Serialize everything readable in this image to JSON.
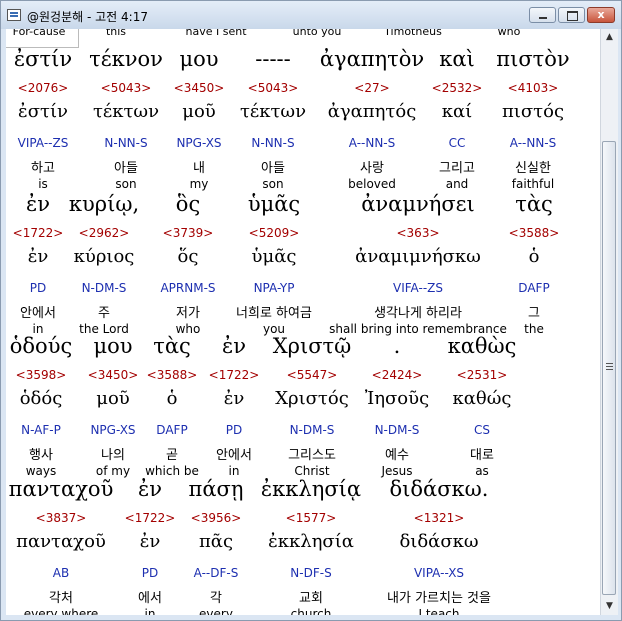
{
  "window": {
    "title": "@원겅분해 - 고전 4:17"
  },
  "window_buttons": {
    "close": "x"
  },
  "header_row": [
    "For-cause",
    "this",
    "have I sent",
    "unto you",
    "Timotheus",
    "who"
  ],
  "blocks": [
    {
      "words": [
        {
          "greek": "ἐστίν",
          "strong": "<2076>",
          "lemma": "ἐστίν",
          "morph": "VIPA--ZS",
          "korean": "하고",
          "english": "is"
        },
        {
          "greek": "τέκνον",
          "strong": "<5043>",
          "lemma": "τέκτων",
          "morph": "N-NN-S",
          "korean": "아들",
          "english": "son"
        },
        {
          "greek": "μου",
          "strong": "<3450>",
          "lemma": "μοῦ",
          "morph": "NPG-XS",
          "korean": "내",
          "english": "my"
        },
        {
          "greek": "-----",
          "strong": "<5043>",
          "lemma": "τέκτων",
          "morph": "N-NN-S",
          "korean": "아들",
          "english": "son"
        },
        {
          "greek": "ἀγαπητὸν",
          "strong": "<27>",
          "lemma": "ἀγαπητός",
          "morph": "A--NN-S",
          "korean": "사랑",
          "english": "beloved"
        },
        {
          "greek": "καὶ",
          "strong": "<2532>",
          "lemma": "καί",
          "morph": "CC",
          "korean": "그리고",
          "english": "and"
        },
        {
          "greek": "πιστὸν",
          "strong": "<4103>",
          "lemma": "πιστός",
          "morph": "A--NN-S",
          "korean": "신실한",
          "english": "faithful"
        }
      ]
    },
    {
      "words": [
        {
          "greek": "ἐν",
          "strong": "<1722>",
          "lemma": "ἐν",
          "morph": "PD",
          "korean": "안에서",
          "english": "in"
        },
        {
          "greek": "κυρίῳ,",
          "strong": "<2962>",
          "lemma": "κύριος",
          "morph": "N-DM-S",
          "korean": "주",
          "english": "the Lord"
        },
        {
          "greek": "ὃς",
          "strong": "<3739>",
          "lemma": "ὅς",
          "morph": "APRNM-S",
          "korean": "저가",
          "english": "who"
        },
        {
          "greek": "ὑμᾶς",
          "strong": "<5209>",
          "lemma": "ὑμᾶς",
          "morph": "NPA-YP",
          "korean": "너희로 하여금",
          "english": "you"
        },
        {
          "greek": "ἀναμνήσει",
          "strong": "<363>",
          "lemma": "ἀναμιμνήσκω",
          "morph": "VIFA--ZS",
          "korean": "생각나게 하리라",
          "english": "shall bring into remembrance"
        },
        {
          "greek": "τὰς",
          "strong": "<3588>",
          "lemma": "ὁ",
          "morph": "DAFP",
          "korean": "그",
          "english": "the"
        }
      ]
    },
    {
      "words": [
        {
          "greek": "ὁδούς",
          "strong": "<3598>",
          "lemma": "ὁδός",
          "morph": "N-AF-P",
          "korean": "행사",
          "english": "ways"
        },
        {
          "greek": "μου",
          "strong": "<3450>",
          "lemma": "μοῦ",
          "morph": "NPG-XS",
          "korean": "나의",
          "english": "of my"
        },
        {
          "greek": "τὰς",
          "strong": "<3588>",
          "lemma": "ὁ",
          "morph": "DAFP",
          "korean": "곧",
          "english": "which be"
        },
        {
          "greek": "ἐν",
          "strong": "<1722>",
          "lemma": "ἐν",
          "morph": "PD",
          "korean": "안에서",
          "english": "in"
        },
        {
          "greek": "Χριστῷ",
          "strong": "<5547>",
          "lemma": "Χριστός",
          "morph": "N-DM-S",
          "korean": "그리스도",
          "english": "Christ"
        },
        {
          "greek": ".",
          "strong": "<2424>",
          "lemma": "Ἰησοῦς",
          "morph": "N-DM-S",
          "korean": "예수",
          "english": "Jesus"
        },
        {
          "greek": "καθὼς",
          "strong": "<2531>",
          "lemma": "καθώς",
          "morph": "CS",
          "korean": "대로",
          "english": "as"
        }
      ]
    },
    {
      "words": [
        {
          "greek": "πανταχοῦ",
          "strong": "<3837>",
          "lemma": "πανταχοῦ",
          "morph": "AB",
          "korean": "각처",
          "english": "every where"
        },
        {
          "greek": "ἐν",
          "strong": "<1722>",
          "lemma": "ἐν",
          "morph": "PD",
          "korean": "에서",
          "english": "in"
        },
        {
          "greek": "πάσῃ",
          "strong": "<3956>",
          "lemma": "πᾶς",
          "morph": "A--DF-S",
          "korean": "각",
          "english": "every"
        },
        {
          "greek": "ἐκκλησίᾳ",
          "strong": "<1577>",
          "lemma": "ἐκκλησία",
          "morph": "N-DF-S",
          "korean": "교회",
          "english": "church"
        },
        {
          "greek": "διδάσκω.",
          "strong": "<1321>",
          "lemma": "διδάσκω",
          "morph": "VIPA--XS",
          "korean": "내가 가르치는 것을",
          "english": "I teach"
        }
      ]
    }
  ]
}
